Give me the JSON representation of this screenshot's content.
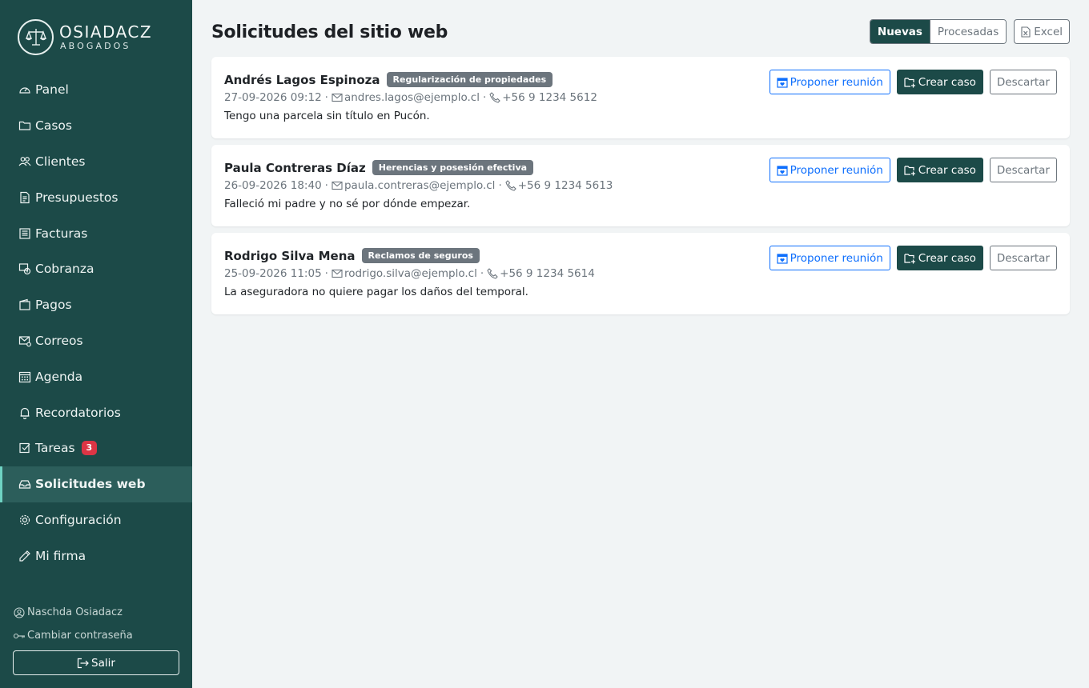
{
  "brand": {
    "name": "OSIADACZ",
    "subtitle": "ABOGADOS",
    "logo_icon": "scales-icon"
  },
  "sidebar": {
    "items": [
      {
        "label": "Panel",
        "icon": "speedometer-icon"
      },
      {
        "label": "Casos",
        "icon": "folder-icon"
      },
      {
        "label": "Clientes",
        "icon": "people-icon"
      },
      {
        "label": "Presupuestos",
        "icon": "document-icon"
      },
      {
        "label": "Facturas",
        "icon": "receipt-icon"
      },
      {
        "label": "Cobranza",
        "icon": "cash-icon"
      },
      {
        "label": "Pagos",
        "icon": "wallet-icon"
      },
      {
        "label": "Correos",
        "icon": "envelope-icon"
      },
      {
        "label": "Agenda",
        "icon": "calendar-icon"
      },
      {
        "label": "Recordatorios",
        "icon": "bell-icon"
      },
      {
        "label": "Tareas",
        "icon": "checkbox-icon",
        "badge": "3"
      },
      {
        "label": "Solicitudes web",
        "icon": "inbox-icon",
        "active": true
      },
      {
        "label": "Configuración",
        "icon": "gear-icon"
      },
      {
        "label": "Mi firma",
        "icon": "pen-icon"
      }
    ],
    "user": "Naschda Osiadacz",
    "change_password": "Cambiar contraseña",
    "logout": "Salir"
  },
  "header": {
    "title": "Solicitudes del sitio web",
    "filter_new": "Nuevas",
    "filter_processed": "Procesadas",
    "excel": "Excel"
  },
  "actions": {
    "propose": "Proponer reunión",
    "create": "Crear caso",
    "discard": "Descartar"
  },
  "requests": [
    {
      "name": "Andrés Lagos Espinoza",
      "tag": "Regularización de propiedades",
      "datetime": "27-09-2026 09:12",
      "email": "andres.lagos@ejemplo.cl",
      "phone": "+56 9 1234 5612",
      "message": "Tengo una parcela sin título en Pucón."
    },
    {
      "name": "Paula Contreras Díaz",
      "tag": "Herencias y posesión efectiva",
      "datetime": "26-09-2026 18:40",
      "email": "paula.contreras@ejemplo.cl",
      "phone": "+56 9 1234 5613",
      "message": "Falleció mi padre y no sé por dónde empezar."
    },
    {
      "name": "Rodrigo Silva Mena",
      "tag": "Reclamos de seguros",
      "datetime": "25-09-2026 11:05",
      "email": "rodrigo.silva@ejemplo.cl",
      "phone": "+56 9 1234 5614",
      "message": "La aseguradora no quiere pagar los daños del temporal."
    }
  ],
  "colors": {
    "sidebar_bg": "#1c4a48",
    "active_item_bg": "#2c5e5b",
    "accent": "#6fd3c3",
    "primary": "#0d6efd",
    "badge_red": "#dc3545",
    "tag_gray": "#6c757d"
  }
}
